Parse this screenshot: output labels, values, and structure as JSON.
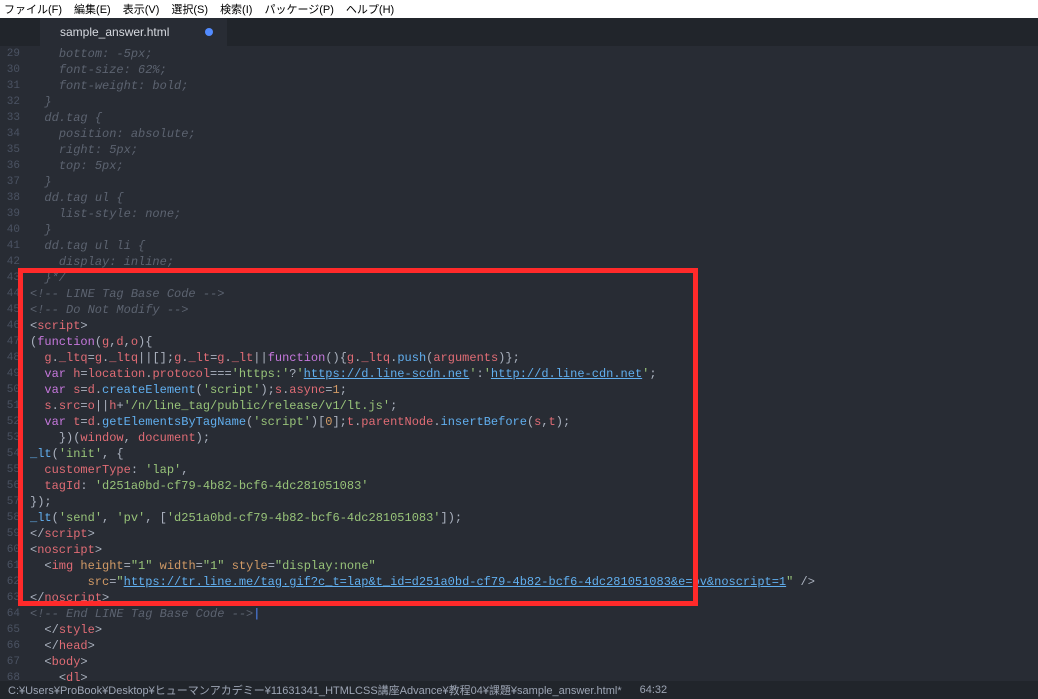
{
  "menu": {
    "file": "ファイル(F)",
    "edit": "編集(E)",
    "view": "表示(V)",
    "select": "選択(S)",
    "search": "検索(I)",
    "packages": "パッケージ(P)",
    "help": "ヘルプ(H)"
  },
  "tab": {
    "title": "sample_answer.html",
    "modified": true
  },
  "gutter": {
    "start": 29,
    "end": 68
  },
  "code": {
    "lines": [
      {
        "t": "csscomment",
        "indent": 2,
        "text": "bottom: -5px;",
        "fade": true
      },
      {
        "t": "csscomment",
        "indent": 2,
        "text": "font-size: 62%;"
      },
      {
        "t": "csscomment",
        "indent": 2,
        "text": "font-weight: bold;"
      },
      {
        "t": "csscomment",
        "indent": 1,
        "text": "}"
      },
      {
        "t": "csscomment",
        "indent": 1,
        "text": "dd.tag {"
      },
      {
        "t": "csscomment",
        "indent": 2,
        "text": "position: absolute;"
      },
      {
        "t": "csscomment",
        "indent": 2,
        "text": "right: 5px;"
      },
      {
        "t": "csscomment",
        "indent": 2,
        "text": "top: 5px;"
      },
      {
        "t": "csscomment",
        "indent": 1,
        "text": "}"
      },
      {
        "t": "csscomment",
        "indent": 1,
        "text": "dd.tag ul {"
      },
      {
        "t": "csscomment",
        "indent": 2,
        "text": "list-style: none;"
      },
      {
        "t": "csscomment",
        "indent": 1,
        "text": "}"
      },
      {
        "t": "csscomment",
        "indent": 1,
        "text": "dd.tag ul li {"
      },
      {
        "t": "csscomment",
        "indent": 2,
        "text": "display: inline;"
      },
      {
        "t": "csscomment",
        "indent": 1,
        "text": "}*/"
      },
      {
        "t": "htmlcomment",
        "indent": 0,
        "text": "<!-- LINE Tag Base Code -->"
      },
      {
        "t": "htmlcomment",
        "indent": 0,
        "text": "<!-- Do Not Modify -->"
      },
      {
        "t": "opentag",
        "indent": 0,
        "tag": "script"
      },
      {
        "t": "js",
        "indent": 0,
        "segments": [
          {
            "c": "punc",
            "v": "("
          },
          {
            "c": "key",
            "v": "function"
          },
          {
            "c": "punc",
            "v": "("
          },
          {
            "c": "id",
            "v": "g"
          },
          {
            "c": "punc",
            "v": ","
          },
          {
            "c": "id",
            "v": "d"
          },
          {
            "c": "punc",
            "v": ","
          },
          {
            "c": "id",
            "v": "o"
          },
          {
            "c": "punc",
            "v": "){"
          }
        ]
      },
      {
        "t": "js",
        "indent": 1,
        "segments": [
          {
            "c": "id",
            "v": "g"
          },
          {
            "c": "punc",
            "v": "."
          },
          {
            "c": "id",
            "v": "_ltq"
          },
          {
            "c": "punc",
            "v": "="
          },
          {
            "c": "id",
            "v": "g"
          },
          {
            "c": "punc",
            "v": "."
          },
          {
            "c": "id",
            "v": "_ltq"
          },
          {
            "c": "punc",
            "v": "||[];"
          },
          {
            "c": "id",
            "v": "g"
          },
          {
            "c": "punc",
            "v": "."
          },
          {
            "c": "id",
            "v": "_lt"
          },
          {
            "c": "punc",
            "v": "="
          },
          {
            "c": "id",
            "v": "g"
          },
          {
            "c": "punc",
            "v": "."
          },
          {
            "c": "id",
            "v": "_lt"
          },
          {
            "c": "punc",
            "v": "||"
          },
          {
            "c": "key",
            "v": "function"
          },
          {
            "c": "punc",
            "v": "(){"
          },
          {
            "c": "id",
            "v": "g"
          },
          {
            "c": "punc",
            "v": "."
          },
          {
            "c": "id",
            "v": "_ltq"
          },
          {
            "c": "punc",
            "v": "."
          },
          {
            "c": "func",
            "v": "push"
          },
          {
            "c": "punc",
            "v": "("
          },
          {
            "c": "id",
            "v": "arguments"
          },
          {
            "c": "punc",
            "v": ")};"
          }
        ]
      },
      {
        "t": "js",
        "indent": 1,
        "segments": [
          {
            "c": "key",
            "v": "var"
          },
          {
            "c": "punc",
            "v": " "
          },
          {
            "c": "id",
            "v": "h"
          },
          {
            "c": "punc",
            "v": "="
          },
          {
            "c": "id",
            "v": "location"
          },
          {
            "c": "punc",
            "v": "."
          },
          {
            "c": "id",
            "v": "protocol"
          },
          {
            "c": "punc",
            "v": "==="
          },
          {
            "c": "str",
            "v": "'https:'"
          },
          {
            "c": "punc",
            "v": "?"
          },
          {
            "c": "str",
            "v": "'"
          },
          {
            "c": "link",
            "v": "https://d.line-scdn.net"
          },
          {
            "c": "str",
            "v": "'"
          },
          {
            "c": "punc",
            "v": ":"
          },
          {
            "c": "str",
            "v": "'"
          },
          {
            "c": "link",
            "v": "http://d.line-cdn.net"
          },
          {
            "c": "str",
            "v": "'"
          },
          {
            "c": "punc",
            "v": ";"
          }
        ]
      },
      {
        "t": "js",
        "indent": 1,
        "segments": [
          {
            "c": "key",
            "v": "var"
          },
          {
            "c": "punc",
            "v": " "
          },
          {
            "c": "id",
            "v": "s"
          },
          {
            "c": "punc",
            "v": "="
          },
          {
            "c": "id",
            "v": "d"
          },
          {
            "c": "punc",
            "v": "."
          },
          {
            "c": "func",
            "v": "createElement"
          },
          {
            "c": "punc",
            "v": "("
          },
          {
            "c": "str",
            "v": "'script'"
          },
          {
            "c": "punc",
            "v": ");"
          },
          {
            "c": "id",
            "v": "s"
          },
          {
            "c": "punc",
            "v": "."
          },
          {
            "c": "id",
            "v": "async"
          },
          {
            "c": "punc",
            "v": "="
          },
          {
            "c": "num",
            "v": "1"
          },
          {
            "c": "punc",
            "v": ";"
          }
        ]
      },
      {
        "t": "js",
        "indent": 1,
        "segments": [
          {
            "c": "id",
            "v": "s"
          },
          {
            "c": "punc",
            "v": "."
          },
          {
            "c": "id",
            "v": "src"
          },
          {
            "c": "punc",
            "v": "="
          },
          {
            "c": "id",
            "v": "o"
          },
          {
            "c": "punc",
            "v": "||"
          },
          {
            "c": "id",
            "v": "h"
          },
          {
            "c": "punc",
            "v": "+"
          },
          {
            "c": "str",
            "v": "'/n/line_tag/public/release/v1/lt.js'"
          },
          {
            "c": "punc",
            "v": ";"
          }
        ]
      },
      {
        "t": "js",
        "indent": 1,
        "segments": [
          {
            "c": "key",
            "v": "var"
          },
          {
            "c": "punc",
            "v": " "
          },
          {
            "c": "id",
            "v": "t"
          },
          {
            "c": "punc",
            "v": "="
          },
          {
            "c": "id",
            "v": "d"
          },
          {
            "c": "punc",
            "v": "."
          },
          {
            "c": "func",
            "v": "getElementsByTagName"
          },
          {
            "c": "punc",
            "v": "("
          },
          {
            "c": "str",
            "v": "'script'"
          },
          {
            "c": "punc",
            "v": ")["
          },
          {
            "c": "num",
            "v": "0"
          },
          {
            "c": "punc",
            "v": "];"
          },
          {
            "c": "id",
            "v": "t"
          },
          {
            "c": "punc",
            "v": "."
          },
          {
            "c": "id",
            "v": "parentNode"
          },
          {
            "c": "punc",
            "v": "."
          },
          {
            "c": "func",
            "v": "insertBefore"
          },
          {
            "c": "punc",
            "v": "("
          },
          {
            "c": "id",
            "v": "s"
          },
          {
            "c": "punc",
            "v": ","
          },
          {
            "c": "id",
            "v": "t"
          },
          {
            "c": "punc",
            "v": ");"
          }
        ]
      },
      {
        "t": "js",
        "indent": 2,
        "segments": [
          {
            "c": "punc",
            "v": "})("
          },
          {
            "c": "id",
            "v": "window"
          },
          {
            "c": "punc",
            "v": ", "
          },
          {
            "c": "id",
            "v": "document"
          },
          {
            "c": "punc",
            "v": ");"
          }
        ]
      },
      {
        "t": "js",
        "indent": 0,
        "segments": [
          {
            "c": "func",
            "v": "_lt"
          },
          {
            "c": "punc",
            "v": "("
          },
          {
            "c": "str",
            "v": "'init'"
          },
          {
            "c": "punc",
            "v": ", {"
          }
        ]
      },
      {
        "t": "js",
        "indent": 1,
        "segments": [
          {
            "c": "id",
            "v": "customerType"
          },
          {
            "c": "punc",
            "v": ": "
          },
          {
            "c": "str",
            "v": "'lap'"
          },
          {
            "c": "punc",
            "v": ","
          }
        ]
      },
      {
        "t": "js",
        "indent": 1,
        "segments": [
          {
            "c": "id",
            "v": "tagId"
          },
          {
            "c": "punc",
            "v": ": "
          },
          {
            "c": "str",
            "v": "'d251a0bd-cf79-4b82-bcf6-4dc281051083'"
          }
        ]
      },
      {
        "t": "js",
        "indent": 0,
        "segments": [
          {
            "c": "punc",
            "v": "});"
          }
        ]
      },
      {
        "t": "js",
        "indent": 0,
        "segments": [
          {
            "c": "func",
            "v": "_lt"
          },
          {
            "c": "punc",
            "v": "("
          },
          {
            "c": "str",
            "v": "'send'"
          },
          {
            "c": "punc",
            "v": ", "
          },
          {
            "c": "str",
            "v": "'pv'"
          },
          {
            "c": "punc",
            "v": ", ["
          },
          {
            "c": "str",
            "v": "'d251a0bd-cf79-4b82-bcf6-4dc281051083'"
          },
          {
            "c": "punc",
            "v": "]);"
          }
        ]
      },
      {
        "t": "closetag",
        "indent": 0,
        "tag": "script"
      },
      {
        "t": "opentag",
        "indent": 0,
        "tag": "noscript"
      },
      {
        "t": "html",
        "indent": 1,
        "segments": [
          {
            "c": "punc",
            "v": "<"
          },
          {
            "c": "tag",
            "v": "img"
          },
          {
            "c": "punc",
            "v": " "
          },
          {
            "c": "attr",
            "v": "height"
          },
          {
            "c": "punc",
            "v": "="
          },
          {
            "c": "str",
            "v": "\"1\""
          },
          {
            "c": "punc",
            "v": " "
          },
          {
            "c": "attr",
            "v": "width"
          },
          {
            "c": "punc",
            "v": "="
          },
          {
            "c": "str",
            "v": "\"1\""
          },
          {
            "c": "punc",
            "v": " "
          },
          {
            "c": "attr",
            "v": "style"
          },
          {
            "c": "punc",
            "v": "="
          },
          {
            "c": "str",
            "v": "\"display:none\""
          }
        ]
      },
      {
        "t": "html",
        "indent": 4,
        "segments": [
          {
            "c": "attr",
            "v": "src"
          },
          {
            "c": "punc",
            "v": "="
          },
          {
            "c": "str",
            "v": "\""
          },
          {
            "c": "link",
            "v": "https://tr.line.me/tag.gif?c_t=lap&t_id=d251a0bd-cf79-4b82-bcf6-4dc281051083&e=pv&noscript=1"
          },
          {
            "c": "str",
            "v": "\""
          },
          {
            "c": "punc",
            "v": " />"
          }
        ]
      },
      {
        "t": "closetag",
        "indent": 0,
        "tag": "noscript"
      },
      {
        "t": "htmlcomment",
        "indent": 0,
        "text": "<!-- End LINE Tag Base Code -->",
        "cursor": true
      },
      {
        "t": "closetag",
        "indent": 1,
        "tag": "style"
      },
      {
        "t": "closetag",
        "indent": 1,
        "tag": "head"
      },
      {
        "t": "opentag",
        "indent": 1,
        "tag": "body"
      },
      {
        "t": "opentag",
        "indent": 2,
        "tag": "dl"
      }
    ]
  },
  "statusbar": {
    "path": "C:¥Users¥ProBook¥Desktop¥ヒューマンアカデミー¥11631341_HTMLCSS講座Advance¥教程04¥課題¥sample_answer.html*",
    "pos": "64:32"
  }
}
